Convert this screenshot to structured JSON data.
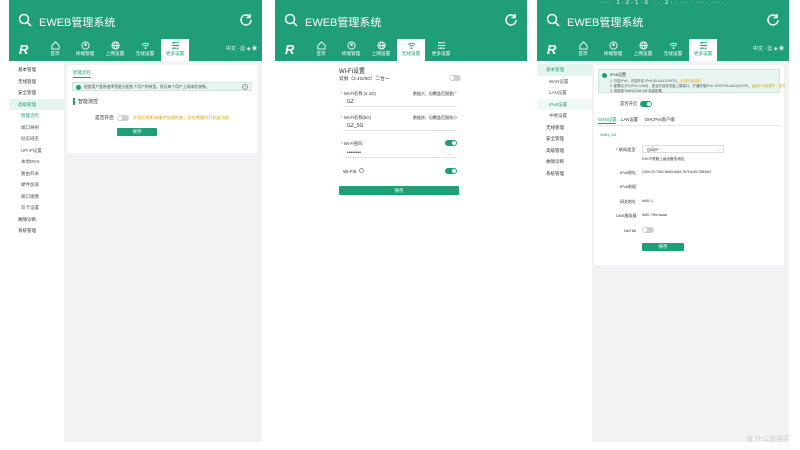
{
  "header": {
    "title": "EWEB管理系统"
  },
  "nav": {
    "logo": "R",
    "tabs": [
      {
        "label": "首页",
        "icon": "home-icon"
      },
      {
        "label": "终端管理",
        "icon": "user-icon"
      },
      {
        "label": "上网设置",
        "icon": "globe-icon"
      },
      {
        "label": "无线设置",
        "icon": "wifi-icon"
      },
      {
        "label": "更多设置",
        "icon": "settings-icon"
      }
    ],
    "lang": "中文 ·"
  },
  "phone1": {
    "sidebar": [
      "基本管理",
      "无线管理",
      "安全管理",
      "高级管理",
      "智能流控",
      "端口映射",
      "动态域名",
      "UPnP设置",
      "本地DNS",
      "路由开关",
      "硬件加速",
      "端口镜像",
      "双卡设置",
      "故障诊断",
      "系统管理"
    ],
    "tab_title": "智能流控",
    "info": "根据用户宽带速率智能分配各个用户的带宽，保证每个用户上网体验流畅。",
    "section": "智能流控",
    "switch_label": "是否开启",
    "warn": "开启后将影响硬件加速性能，仅在需要时开启此功能",
    "save": "保存"
  },
  "phone2": {
    "title": "Wi-Fi设置",
    "dual": "双频（2.4G/5G）二合一",
    "name24_label": "Wi-Fi名称 (2.4G)",
    "name24_hint": "数据大、但覆盖范围更广",
    "name24_value": "GZ",
    "name5_label": "Wi-Fi名称(5G)",
    "name5_hint": "数据快、但覆盖范围较小",
    "name5_value": "GZ_5G",
    "pwd_label": "Wi-Fi密码",
    "pwd_value": "••••••••",
    "wifi6_label": "Wi-Fi6",
    "save": "保存"
  },
  "phone3": {
    "statusbar": "··· 1·2·1·3 ·· 2··  ··· ··· ···",
    "sidebar": [
      "基本管理",
      "WAN设置",
      "LAN设置",
      "IPv6设置",
      "中继设置",
      "无线管理",
      "安全管理",
      "高级管理",
      "故障诊断",
      "系统管理"
    ],
    "info_title": "IPv6设置",
    "info_l1": "1. 开启IPv6，光猫开启 IPv6 (SLAAC/DHCP)，",
    "info_l1b": "必须开启功能",
    "info_l2": "2. 配置后才与IPv4 LAN对，配合开启除流量上路端口，开通终端IPv6: DHCP/SLAAC(DHCP)，",
    "info_l2b": "高级IPv6设置中，另外",
    "info_l3": "3. 请使用\"WAN口/WLAN\"或者配置。",
    "switch_label": "是否开启",
    "tabs": [
      "WAN设置",
      "LAN设置",
      "DHCPv6客户端"
    ],
    "wan_tag": "WAN_6A",
    "conn_label": "* 联网类型",
    "conn_value": "自动IP",
    "conn_hint": "DHCP获取上级设备的地址",
    "ipv6_label": "IPv6地址",
    "ipv6_value": "240e:33:7061:8b83:6a0f:7b7f:fe35:7583/64",
    "ipv6_prefix_label": "IPv6前缀",
    "gateway_label": "网关地址",
    "gateway_value": "fe80::1",
    "dns_label": "DNS服务器",
    "dns_value": "fe80::7fee:aaaa",
    "nat_label": "NAT66",
    "save": "保存"
  },
  "watermark": "值 什么值得买"
}
